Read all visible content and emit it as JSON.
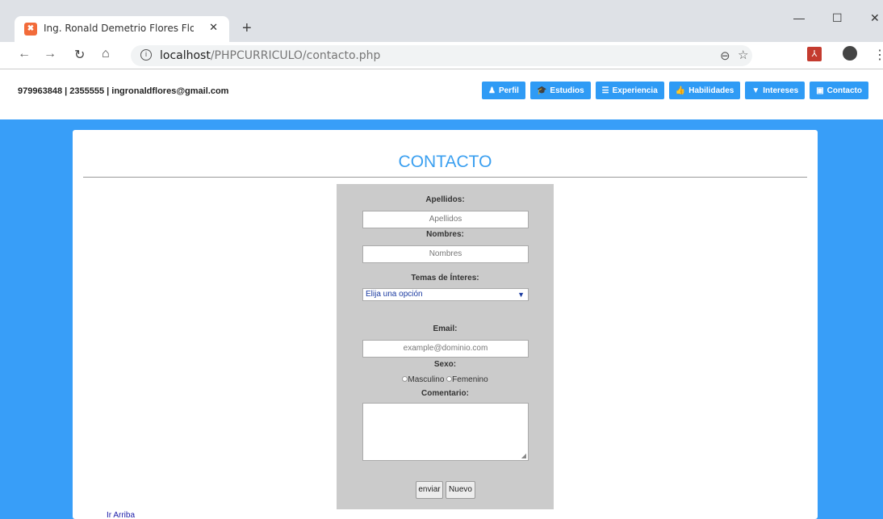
{
  "browser": {
    "tab_title": "Ing. Ronald Demetrio Flores Flores",
    "tab_close": "✕",
    "new_tab": "+",
    "url_host": "localhost",
    "url_path": "/PHPCURRICULO/contacto.php",
    "win_minimize": "—",
    "win_maximize": "☐",
    "win_close": "✕"
  },
  "header": {
    "contact_line": "979963848 | 2355555 | ingronaldflores@gmail.com",
    "nav": [
      {
        "label": "Perfil",
        "icon": "person-icon",
        "glyph": "♟"
      },
      {
        "label": "Estudios",
        "icon": "graduation-cap-icon",
        "glyph": "🎓"
      },
      {
        "label": "Experiencia",
        "icon": "database-icon",
        "glyph": "☰"
      },
      {
        "label": "Habilidades",
        "icon": "thumbs-up-icon",
        "glyph": "👍"
      },
      {
        "label": "Intereses",
        "icon": "filter-icon",
        "glyph": "▼"
      },
      {
        "label": "Contacto",
        "icon": "contact-card-icon",
        "glyph": "▣"
      }
    ]
  },
  "main": {
    "title": "CONTACTO",
    "form": {
      "apellidos_label": "Apellidos:",
      "apellidos_placeholder": "Apellidos",
      "nombres_label": "Nombres:",
      "nombres_placeholder": "Nombres",
      "temas_label": "Temas de Ínteres:",
      "temas_selected": "Elija una opción",
      "email_label": "Email:",
      "email_placeholder": "example@dominio.com",
      "sexo_label": "Sexo:",
      "sexo_options": [
        "Masculino",
        "Femenino"
      ],
      "comentario_label": "Comentario:",
      "enviar": "enviar",
      "nuevo": "Nuevo"
    },
    "ir_arriba": "Ir Arriba"
  },
  "colors": {
    "page_blue": "#389ef8",
    "nav_button": "#2f9bf5",
    "title_blue": "#3a9ff0",
    "form_gray": "#cbcbcb"
  }
}
